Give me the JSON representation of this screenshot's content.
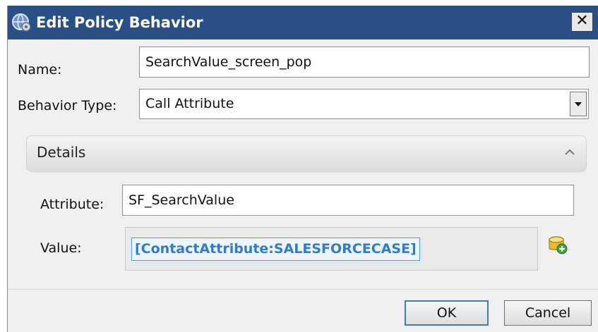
{
  "dialog": {
    "title": "Edit Policy Behavior",
    "close_glyph": "✕"
  },
  "form": {
    "name_label": "Name:",
    "name_value": "SearchValue_screen_pop",
    "behavior_type_label": "Behavior Type:",
    "behavior_type_value": "Call Attribute"
  },
  "details": {
    "header": "Details",
    "attribute_label": "Attribute:",
    "attribute_value": "SF_SearchValue",
    "value_label": "Value:",
    "value_token": "[ContactAttribute:SALESFORCECASE]"
  },
  "buttons": {
    "ok": "OK",
    "cancel": "Cancel"
  },
  "colors": {
    "titlebar": "#2a4f86",
    "token_text": "#2f7ccc",
    "token_border": "#5a9ad8"
  },
  "icons": {
    "title": "globe-gear-icon",
    "combo": "dropdown-arrow-icon",
    "details": "chevron-up-icon",
    "add": "database-add-icon"
  }
}
